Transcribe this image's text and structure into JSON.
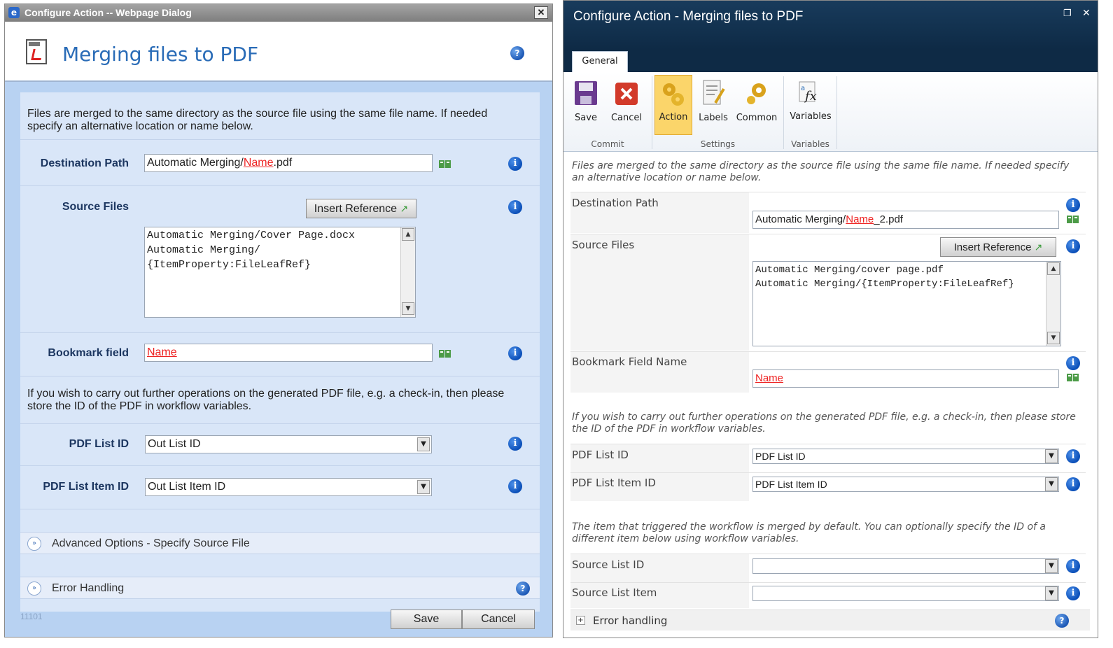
{
  "left": {
    "window_title": "Configure Action -- Webpage Dialog",
    "close_glyph": "✕",
    "heading": "Merging files to PDF",
    "intro": "Files are merged to the same directory as the source file using the same file name. If needed specify an alternative location or name below.",
    "destination_label": "Destination Path",
    "destination_prefix": "Automatic Merging/",
    "destination_ref": "Name",
    "destination_suffix": ".pdf",
    "source_label": "Source Files",
    "insert_reference": "Insert Reference",
    "source_text": "Automatic Merging/Cover Page.docx\nAutomatic Merging/\n{ItemProperty:FileLeafRef}",
    "bookmark_label": "Bookmark field",
    "bookmark_ref": "Name",
    "note": "If you wish to carry out further operations on the generated PDF file, e.g. a check-in, then please store the ID of the PDF in workflow variables.",
    "pdf_list_id_label": "PDF List ID",
    "pdf_list_id_value": "Out List ID",
    "pdf_list_item_label": "PDF List Item ID",
    "pdf_list_item_value": "Out List Item ID",
    "advanced_label": "Advanced Options - Specify Source File",
    "error_label": "Error Handling",
    "build": "11101",
    "save": "Save",
    "cancel": "Cancel"
  },
  "right": {
    "window_title": "Configure Action - Merging files to PDF",
    "restore_glyph": "❐",
    "close_glyph": "✕",
    "tab_general": "General",
    "ribbon": {
      "save": "Save",
      "cancel": "Cancel",
      "action": "Action",
      "labels": "Labels",
      "common": "Common",
      "variables": "Variables",
      "group_commit": "Commit",
      "group_settings": "Settings",
      "group_variables": "Variables"
    },
    "intro": "Files are merged to the same directory as the source file using the same file name. If needed specify an alternative location or name below.",
    "destination_label": "Destination Path",
    "destination_prefix": "Automatic Merging/",
    "destination_ref": "Name",
    "destination_suffix": "_2.pdf",
    "source_label": "Source Files",
    "insert_reference": "Insert Reference",
    "source_text": "Automatic Merging/cover page.pdf\nAutomatic Merging/{ItemProperty:FileLeafRef}",
    "bookmark_label": "Bookmark Field Name",
    "bookmark_ref": "Name",
    "note": "If you wish to carry out further operations on the generated PDF file, e.g. a check-in, then please store the ID of the PDF in workflow variables.",
    "pdf_list_id_label": "PDF List ID",
    "pdf_list_id_value": "PDF List ID",
    "pdf_list_item_label": "PDF List Item ID",
    "pdf_list_item_value": "PDF List Item ID",
    "note2": "The item that triggered the workflow is merged by default. You can optionally specify the ID of a different item below using workflow variables.",
    "source_list_id_label": "Source List ID",
    "source_list_item_label": "Source List Item",
    "error_label": "Error handling"
  },
  "icons": {
    "info": "info-icon",
    "help": "help-icon",
    "reference": "insert-reference-icon",
    "expand": "expand-icon",
    "pdf": "pdf-document-icon"
  },
  "colors": {
    "left_body": "#d9e6f8",
    "left_heading": "#2a6cb7",
    "right_header": "#0e2a45",
    "reference_text": "#ee2222"
  }
}
